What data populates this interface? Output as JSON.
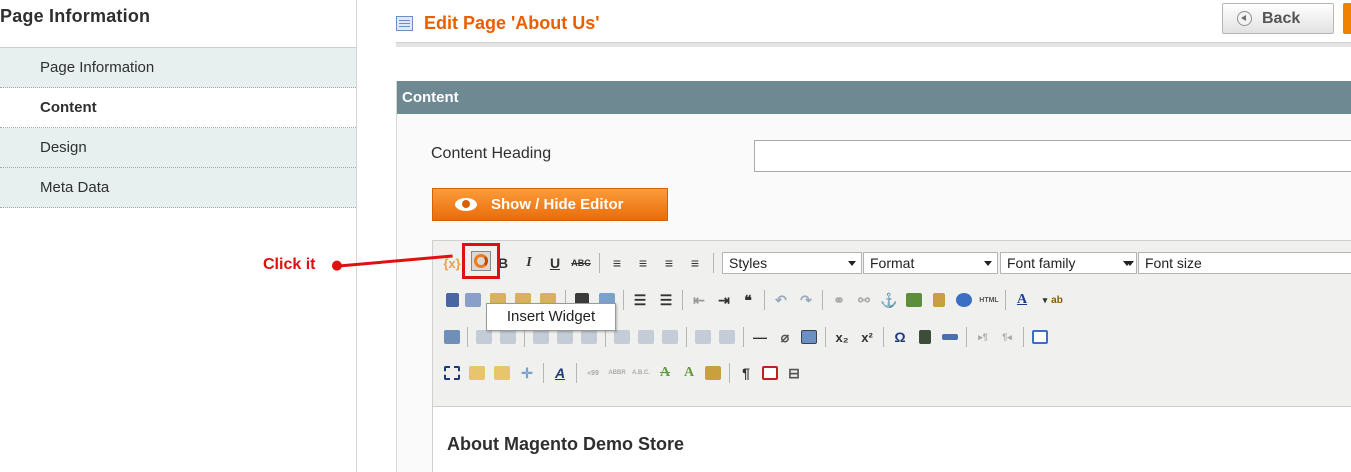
{
  "sidebar": {
    "title": "Page Information",
    "tabs": [
      {
        "label": "Page Information",
        "active": false
      },
      {
        "label": "Content",
        "active": true
      },
      {
        "label": "Design",
        "active": false
      },
      {
        "label": "Meta Data",
        "active": false
      }
    ]
  },
  "header": {
    "title": "Edit Page 'About Us'",
    "back_label": "Back"
  },
  "section": {
    "title": "Content",
    "content_heading_label": "Content Heading",
    "content_heading_value": "",
    "toggle_editor_label": "Show / Hide Editor"
  },
  "editor": {
    "dropdowns": {
      "styles": "Styles",
      "format": "Format",
      "font_family": "Font family",
      "font_size": "Font size"
    },
    "tooltip": "Insert Widget",
    "body_heading": "About Magento Demo Store"
  },
  "annotation": {
    "text": "Click it",
    "color": "#e01010"
  },
  "colors": {
    "accent": "#eb5e00",
    "section_header": "#6f8992",
    "button_orange": "#f18200"
  }
}
